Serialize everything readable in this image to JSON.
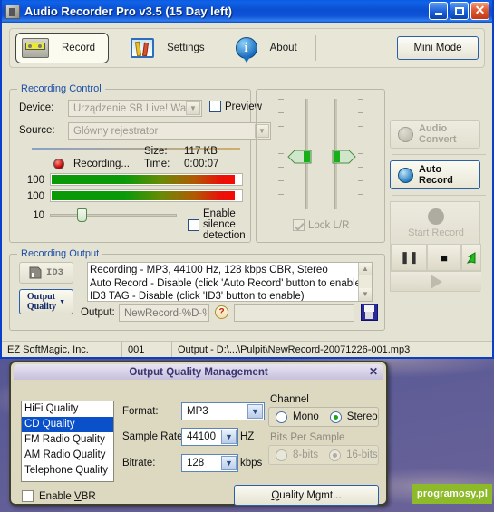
{
  "window": {
    "title": "Audio Recorder Pro v3.5 (15 Day left)",
    "minimize_label": "",
    "maximize_label": "",
    "close_label": "✕"
  },
  "toolbar": {
    "record_label": "Record",
    "settings_label": "Settings",
    "about_label": "About",
    "info_glyph": "i",
    "mini_mode_label": "Mini Mode"
  },
  "recording_control": {
    "title": "Recording Control",
    "device_label": "Device:",
    "device_value": "Urządzenie SB Live! Wave",
    "source_label": "Source:",
    "source_value": "Główny rejestrator",
    "preview_label": "Preview",
    "preview_checked": false,
    "status_label": "Recording...",
    "size_label": "Size:",
    "size_value": "117 KB",
    "time_label": "Time:",
    "time_value": "0:00:07",
    "meter_left_value": "100",
    "meter_right_value": "100",
    "silence_threshold_value": "10",
    "silence_label": "Enable silence detection",
    "silence_checked": false,
    "lock_lr_label": "Lock L/R",
    "lock_lr_checked": true
  },
  "recording_output": {
    "title": "Recording Output",
    "id3_label": "ID3",
    "output_quality_label_line1": "Output",
    "output_quality_label_line2": "Quality",
    "log_lines": [
      "Recording - MP3, 44100 Hz, 128 kbps CBR, Stereo",
      "Auto Record - Disable (click 'Auto Record' button to enable)",
      "ID3 TAG - Disable (click 'ID3' button to enable)"
    ],
    "output_label": "Output:",
    "output_placeholder": "NewRecord-%D-%S",
    "output_value": "",
    "help_glyph": "?",
    "folder_value": ""
  },
  "actions": {
    "audio_convert_line1": "Audio",
    "audio_convert_line2": "Convert",
    "auto_record_line1": "Auto",
    "auto_record_line2": "Record",
    "start_record_label": "Start Record",
    "pause_label": "❚❚",
    "stop_label": "■",
    "play_label": "▶"
  },
  "statusbar": {
    "company": "EZ SoftMagic, Inc.",
    "counter": "001",
    "output_path": "Output - D:\\...\\Pulpit\\NewRecord-20071226-001.mp3"
  },
  "dialog": {
    "title": "Output Quality Management",
    "close_label": "✕",
    "quality_presets": [
      "HiFi Quality",
      "CD Quality",
      "FM Radio Quality",
      "AM Radio Quality",
      "Telephone Quality"
    ],
    "quality_selected_index": 1,
    "format_label": "Format:",
    "format_value": "MP3",
    "sample_rate_label": "Sample Rate:",
    "sample_rate_value": "44100",
    "sample_rate_unit": "HZ",
    "bitrate_label": "Bitrate:",
    "bitrate_value": "128",
    "bitrate_unit": "kbps",
    "channel_label": "Channel",
    "mono_label": "Mono",
    "stereo_label": "Stereo",
    "channel_selected": "Stereo",
    "bits_label": "Bits Per Sample",
    "bits_8_label": "8-bits",
    "bits_16_label": "16-bits",
    "bits_selected": "16-bits",
    "enable_vbr_label_pre": "Enable ",
    "enable_vbr_label_u": "V",
    "enable_vbr_label_post": "BR",
    "enable_vbr_checked": false,
    "quality_mgmt_label_u": "Q",
    "quality_mgmt_label_post": "uality Mgmt..."
  },
  "desktop": {
    "watermark": "programosy.pl"
  }
}
